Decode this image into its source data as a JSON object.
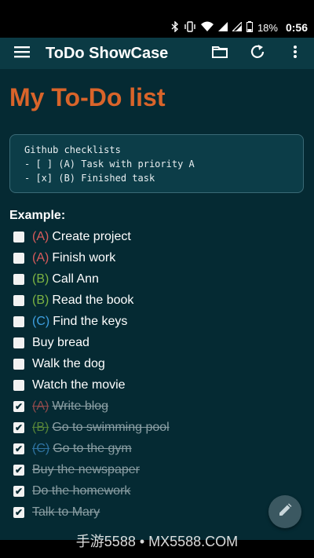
{
  "status_bar": {
    "battery": "18%",
    "time": "0:56",
    "icons": [
      "bluetooth-icon",
      "vibrate-icon",
      "wifi-icon",
      "signal-icon",
      "signal-icon",
      "battery-icon"
    ]
  },
  "app_bar": {
    "title": "ToDo ShowCase",
    "icons": [
      "menu-icon",
      "folder-icon",
      "refresh-icon",
      "more-vert-icon"
    ]
  },
  "content": {
    "heading": "My To-Do list",
    "code_lines": [
      "Github checklists",
      "- [ ] (A) Task with priority A",
      "- [x] (B) Finished task"
    ],
    "example_label": "Example:",
    "items": [
      {
        "priority": "(A)",
        "priority_color": "#d95b5b",
        "text": "Create project",
        "checked": false
      },
      {
        "priority": "(A)",
        "priority_color": "#d95b5b",
        "text": "Finish work",
        "checked": false
      },
      {
        "priority": "(B)",
        "priority_color": "#7cb342",
        "text": "Call Ann",
        "checked": false
      },
      {
        "priority": "(B)",
        "priority_color": "#7cb342",
        "text": "Read the book",
        "checked": false
      },
      {
        "priority": "(C)",
        "priority_color": "#3f9fe0",
        "text": "Find the keys",
        "checked": false
      },
      {
        "priority": "",
        "priority_color": "",
        "text": "Buy bread",
        "checked": false
      },
      {
        "priority": "",
        "priority_color": "",
        "text": "Walk the dog",
        "checked": false
      },
      {
        "priority": "",
        "priority_color": "",
        "text": "Watch the movie",
        "checked": false
      },
      {
        "priority": "(A)",
        "priority_color": "#b55252",
        "text": "Write blog",
        "checked": true
      },
      {
        "priority": "(B)",
        "priority_color": "#6a9a3a",
        "text": "Go to swimming pool",
        "checked": true
      },
      {
        "priority": "(C)",
        "priority_color": "#3a86bd",
        "text": "Go to the gym",
        "checked": true
      },
      {
        "priority": "",
        "priority_color": "",
        "text": "Buy the newspaper",
        "checked": true
      },
      {
        "priority": "",
        "priority_color": "",
        "text": "Do the homework",
        "checked": true
      },
      {
        "priority": "",
        "priority_color": "",
        "text": "Talk to Mary",
        "checked": true
      }
    ],
    "fab_icon": "pencil-icon"
  },
  "watermark": "手游5588 • MX5588.COM",
  "colors": {
    "app_bar": "#0b3a44",
    "background": "#052a33",
    "heading": "#d9642a"
  }
}
